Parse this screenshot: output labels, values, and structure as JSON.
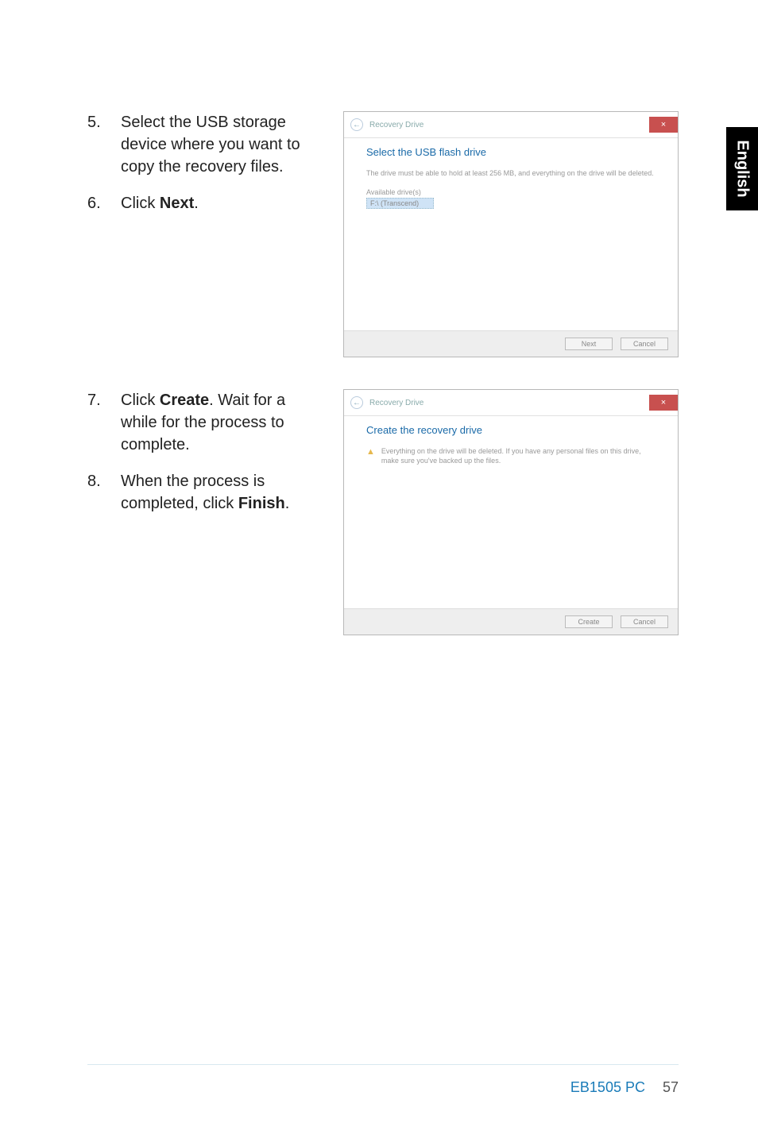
{
  "tab": {
    "label": "English"
  },
  "steps": {
    "s5": {
      "num": "5.",
      "text": "Select the USB storage device where you want to copy the recovery files."
    },
    "s6": {
      "num": "6.",
      "text_pre": "Click ",
      "text_bold": "Next",
      "text_post": "."
    },
    "s7": {
      "num": "7.",
      "text_pre": "Click ",
      "text_bold": "Create",
      "text_post": ". Wait for a while for the process to complete."
    },
    "s8": {
      "num": "8.",
      "text_pre": "When the process is completed, click ",
      "text_bold": "Finish",
      "text_post": "."
    }
  },
  "dialog1": {
    "breadcrumb": "Recovery Drive",
    "close": "×",
    "title": "Select the USB flash drive",
    "hint": "The drive must be able to hold at least 256 MB, and everything on the drive will be deleted.",
    "avail_label": "Available drive(s)",
    "drive_item": "F:\\ (Transcend)",
    "btn_next": "Next",
    "btn_cancel": "Cancel"
  },
  "dialog2": {
    "breadcrumb": "Recovery Drive",
    "close": "×",
    "title": "Create the recovery drive",
    "warn": "Everything on the drive will be deleted. If you have any personal files on this drive, make sure you've backed up the files.",
    "btn_create": "Create",
    "btn_cancel": "Cancel"
  },
  "footer": {
    "model": "EB1505 PC",
    "page": "57"
  }
}
